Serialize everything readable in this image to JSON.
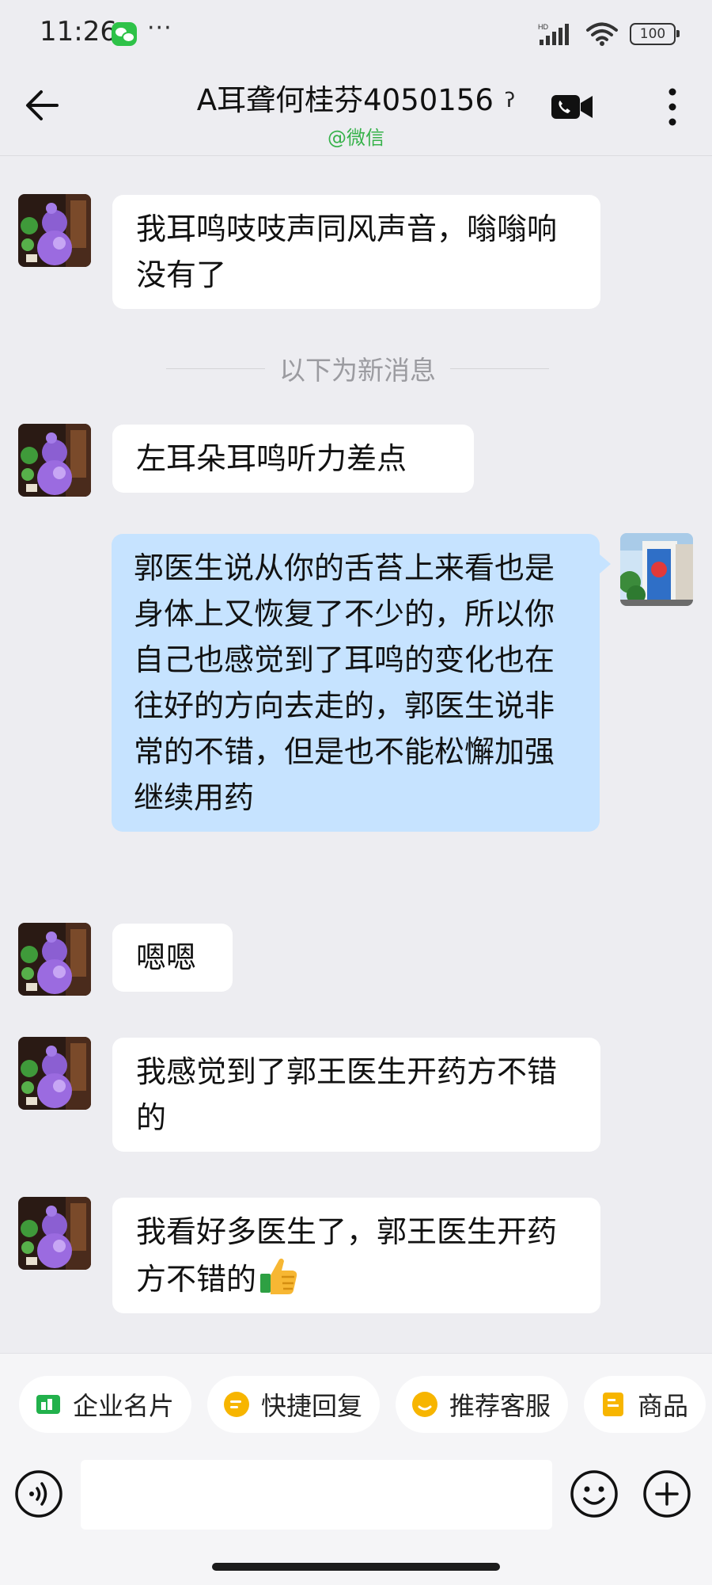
{
  "status_bar": {
    "time": "11:26",
    "dots": "···",
    "battery": "100"
  },
  "header": {
    "title": "A耳聋何桂芬4050156",
    "subtitle": "@微信"
  },
  "messages": {
    "m1": "我耳鸣吱吱声同风声音，嗡嗡响没有了",
    "divider": "以下为新消息",
    "m2": "左耳朵耳鸣听力差点",
    "m3": "郭医生说从你的舌苔上来看也是身体上又恢复了不少的，所以你自己也感觉到了耳鸣的变化也在往好的方向去走的，郭医生说非常的不错，但是也不能松懈加强继续用药",
    "m4": "嗯嗯",
    "m5": "我感觉到了郭王医生开药方不错的",
    "m6": "我看好多医生了，郭王医生开药方不错的"
  },
  "quick_actions": [
    "企业名片",
    "快捷回复",
    "推荐客服",
    "商品"
  ],
  "icons": {
    "back": "back-arrow-icon",
    "help": "question-icon",
    "video": "video-call-icon",
    "more": "more-vertical-icon",
    "thumbs": "thumbs-up-emoji",
    "voice": "voice-input-icon",
    "emoji": "emoji-icon",
    "plus": "plus-icon"
  },
  "colors": {
    "self_bubble": "#c6e3ff",
    "accent_green": "#36b24a",
    "chip_green": "#22b14c",
    "chip_yellow": "#f7b500"
  }
}
